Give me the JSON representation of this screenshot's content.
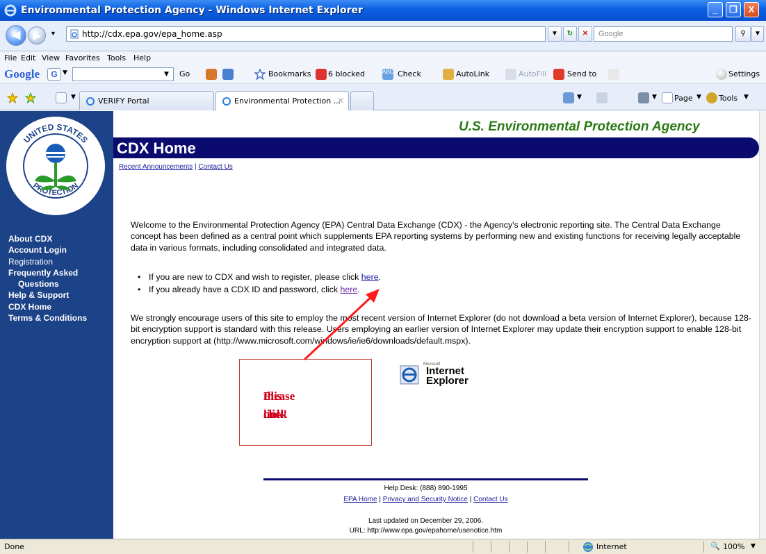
{
  "window": {
    "title": "Environmental Protection Agency - Windows Internet Explorer",
    "buttons": [
      "_",
      "❐",
      "X"
    ]
  },
  "address_bar": {
    "url": "http://cdx.epa.gov/epa_home.asp",
    "search_placeholder": "Google"
  },
  "menu": {
    "items": [
      "File",
      "Edit",
      "View",
      "Favorites",
      "Tools",
      "Help"
    ]
  },
  "google_toolbar": {
    "logo": "Google",
    "go": "Go",
    "bookmarks": "Bookmarks",
    "blocked": "6 blocked",
    "check": "Check",
    "autolink": "AutoLink",
    "autofill": "AutoFill",
    "send_to": "Send to",
    "settings": "Settings"
  },
  "tabs": {
    "items": [
      {
        "label": "VERIFY Portal"
      },
      {
        "label": "Environmental Protection ..."
      }
    ],
    "commands": {
      "page": "Page",
      "tools": "Tools"
    }
  },
  "page": {
    "agency_title": "U.S. Environmental Protection Agency",
    "banner": "CDX Home",
    "top_links": {
      "announcements": "Recent Announcements",
      "separator": " | ",
      "contact": "Contact Us"
    },
    "sidebar": {
      "nav": [
        "About CDX",
        "Account Login",
        "Registration",
        "Frequently Asked",
        "Questions",
        "Help & Support",
        "CDX Home",
        "Terms & Conditions"
      ]
    },
    "welcome": "Welcome to the Environmental Protection Agency (EPA) Central Data Exchange (CDX) - the Agency's electronic reporting site. The Central Data Exchange concept has been defined as a central point which supplements EPA reporting systems by performing new and existing functions for receiving legally acceptable data in various formats, including consolidated and integrated data.",
    "bullets": [
      {
        "text": "If you are new to CDX and wish to register, please click ",
        "link": "here"
      },
      {
        "text": "If you already have a CDX ID and password, click ",
        "link": "here"
      }
    ],
    "bullet_end": ".",
    "encourage": "We strongly encourage users of this site to employ the most recent version of Internet Explorer (do not download a beta version of Internet Explorer), because 128-bit encryption support is standard with this release. Users employing an earlier version of Internet Explorer may update their encryption support to enable 128-bit encryption support at (http://www.microsoft.com/windows/ie/ie6/downloads/default.mspx).",
    "ie_badge": {
      "small": "Microsoft",
      "line1": "Internet",
      "line2": "Explorer"
    },
    "callout": {
      "line1": "Please click",
      "line2": "this link!"
    },
    "footer": {
      "helpdesk": "Help Desk: (888) 890-1995",
      "links": [
        "EPA Home",
        "Privacy and Security Notice",
        "Contact Us"
      ],
      "sep": " | ",
      "updated": "Last updated on December 29, 2006.",
      "url": "URL: http://www.epa.gov/epahome/usenotice.htm"
    },
    "seal_text": {
      "top": "UNITED STATES",
      "left": "ENVIRONMENTAL",
      "bottom": "PROTECTION",
      "right": "AGENCY"
    }
  },
  "status_bar": {
    "status": "Done",
    "zone": "Internet",
    "zoom": "100%"
  },
  "colors": {
    "sidebar": "#1c4287",
    "banner": "#0a0a6f",
    "agency_title": "#2a7a14",
    "callout_text": "#d0021b",
    "link": "#1b1b9b"
  }
}
